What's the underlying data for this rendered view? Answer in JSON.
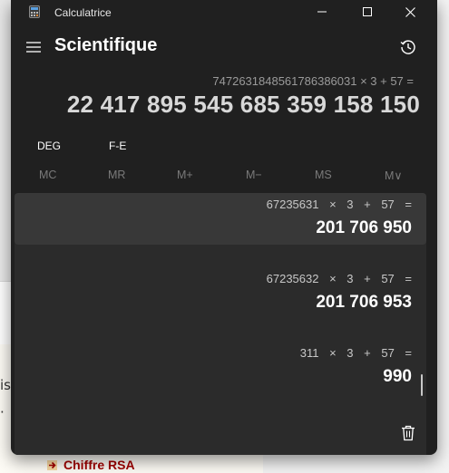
{
  "background": {
    "fragment_1": "ist",
    "fragment_2": "·",
    "link_text": "Chiffre RSA",
    "link_color": "#a10000"
  },
  "window": {
    "app_title": "Calculatrice",
    "mode_title": "Scientifique"
  },
  "display": {
    "expression": "7472631848561786386031 × 3 + 57 =",
    "result": "22 417 895 545 685 359 158 150"
  },
  "modes": {
    "angle": "DEG",
    "format": "F-E"
  },
  "memory": {
    "mc": "MC",
    "mr": "MR",
    "m_plus": "M+",
    "m_minus": "M−",
    "ms": "MS",
    "m_list": "M∨"
  },
  "history": [
    {
      "expression": "67235631 × 3 + 57 =",
      "result": "201 706 950"
    },
    {
      "expression": "67235632 × 3 + 57 =",
      "result": "201 706 953"
    },
    {
      "expression": "311 × 3 + 57 =",
      "result": "990"
    }
  ],
  "icons": {
    "app": "calculator-icon",
    "menu": "hamburger-icon",
    "history": "history-icon",
    "delete": "trash-icon"
  },
  "colors": {
    "window_bg": "#202020",
    "history_bg": "#2b2b2b",
    "selected_bg": "#383838",
    "muted_text": "#9a9a9a"
  }
}
